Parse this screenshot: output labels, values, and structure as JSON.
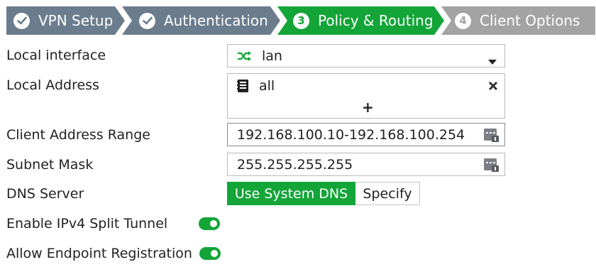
{
  "wizard": {
    "steps": [
      {
        "label": "VPN Setup",
        "badge": "",
        "state": "completed"
      },
      {
        "label": "Authentication",
        "badge": "",
        "state": "completed"
      },
      {
        "label": "Policy & Routing",
        "badge": "3",
        "state": "active"
      },
      {
        "label": "Client Options",
        "badge": "4",
        "state": "pending"
      }
    ]
  },
  "colors": {
    "completed": "#6b7c8d",
    "active": "#13a538",
    "pending": "#a3a3a3",
    "toggle_on": "#13a538"
  },
  "form": {
    "local_interface": {
      "label": "Local interface",
      "value": "lan",
      "icon": "interface-icon"
    },
    "local_address": {
      "label": "Local Address",
      "value": "all",
      "icon": "address-book-icon",
      "add": "+"
    },
    "client_range": {
      "label": "Client Address Range",
      "value": "192.168.100.10-192.168.100.254"
    },
    "subnet_mask": {
      "label": "Subnet Mask",
      "value": "255.255.255.255"
    },
    "dns_server": {
      "label": "DNS Server",
      "options": [
        "Use System DNS",
        "Specify"
      ],
      "selected": "Use System DNS"
    },
    "split_tunnel": {
      "label": "Enable IPv4 Split Tunnel",
      "enabled": true
    },
    "endpoint_registration": {
      "label": "Allow Endpoint Registration",
      "enabled": true
    }
  }
}
